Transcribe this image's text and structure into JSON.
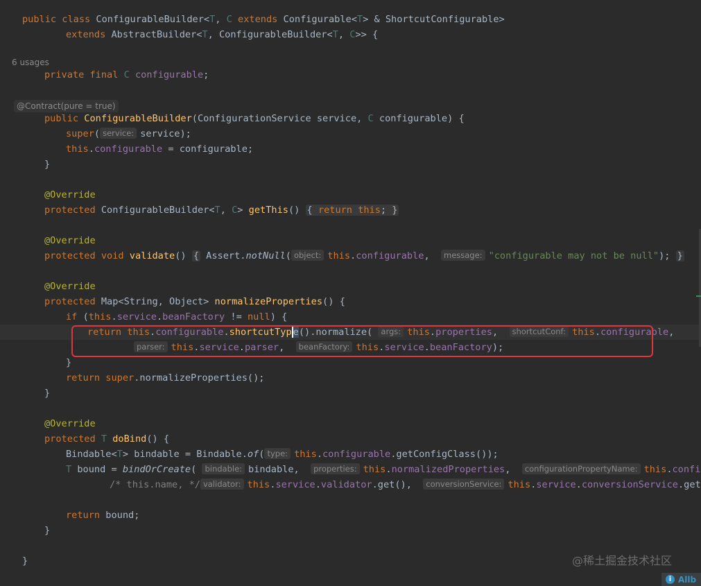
{
  "editor": {
    "usages_hint": "6 usages",
    "contract_hint": "@Contract(pure = true)",
    "hints": {
      "service": "service:",
      "object": "object:",
      "message": "message:",
      "args": "args:",
      "shortcut_conf": "shortcutConf:",
      "parser": "parser:",
      "bean_factory": "beanFactory:",
      "type": "type:",
      "bindable": "bindable:",
      "properties": "properties:",
      "configuration_property_name": "configurationPropertyName:",
      "validator": "validator:",
      "conversion_service": "conversionService:"
    },
    "strings": {
      "null_message": "\"configurable may not be null\""
    },
    "truncated_tail": "this.configurabl"
  },
  "watermark": "@稀土掘金技术社区",
  "notification": {
    "icon": "info-icon",
    "text": "Allb"
  },
  "colors": {
    "background": "#2b2b2b",
    "keyword": "#cc7832",
    "field": "#9876aa",
    "method": "#ffc66d",
    "annotation": "#bbb529",
    "string": "#6a8759",
    "highlight_box": "#e0353a"
  }
}
